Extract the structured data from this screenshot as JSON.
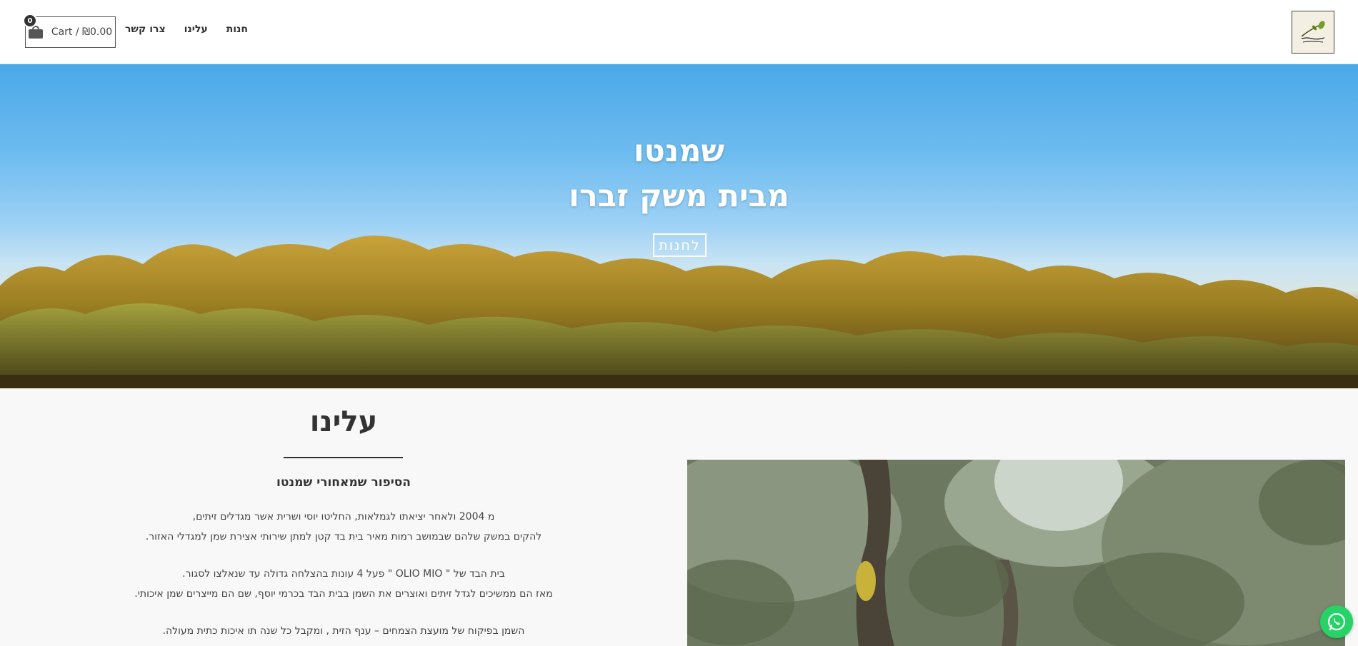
{
  "header": {
    "cart": {
      "label": "Cart / ₪0.00",
      "count": "0"
    },
    "nav": [
      {
        "label": "צרו קשר"
      },
      {
        "label": "עלינו"
      },
      {
        "label": "חנות"
      }
    ],
    "logo_icon": "olive-branch-logo"
  },
  "hero": {
    "line1": "שמנטו",
    "line2": "מבית משק זברו",
    "button_label": "לחנות"
  },
  "about": {
    "title": "עלינו",
    "subtitle": "הסיפור שמאחורי שמנטו",
    "paragraphs": [
      "מ 2004 ולאחר יציאתו לגמלאות, החליטו יוסי ושרית אשר מגדלים זיתים,",
      "להקים במשק שלהם שבמושב רמות מאיר בית בד קטן למתן שירותי אצירת שמן למגדלי האזור.",
      "בית הבד של \" OLIO MIO \" פעל 4 עונות בהצלחה גדולה עד שנאלצו לסגור.",
      "מאז הם ממשיכים לגדל זיתים ואוצרים את השמן בבית הבד בכרמי יוסף, שם הם מייצרים שמן איכותי.",
      "השמן בפיקוח של מועצת הצמחים – ענף הזית , ומקבל כל שנה תו איכות כתית מעולה."
    ]
  },
  "colors": {
    "accent": "#25d366",
    "text": "#333333",
    "sky": "#4aa8e8"
  },
  "floating": {
    "whatsapp_icon": "whatsapp-icon"
  }
}
